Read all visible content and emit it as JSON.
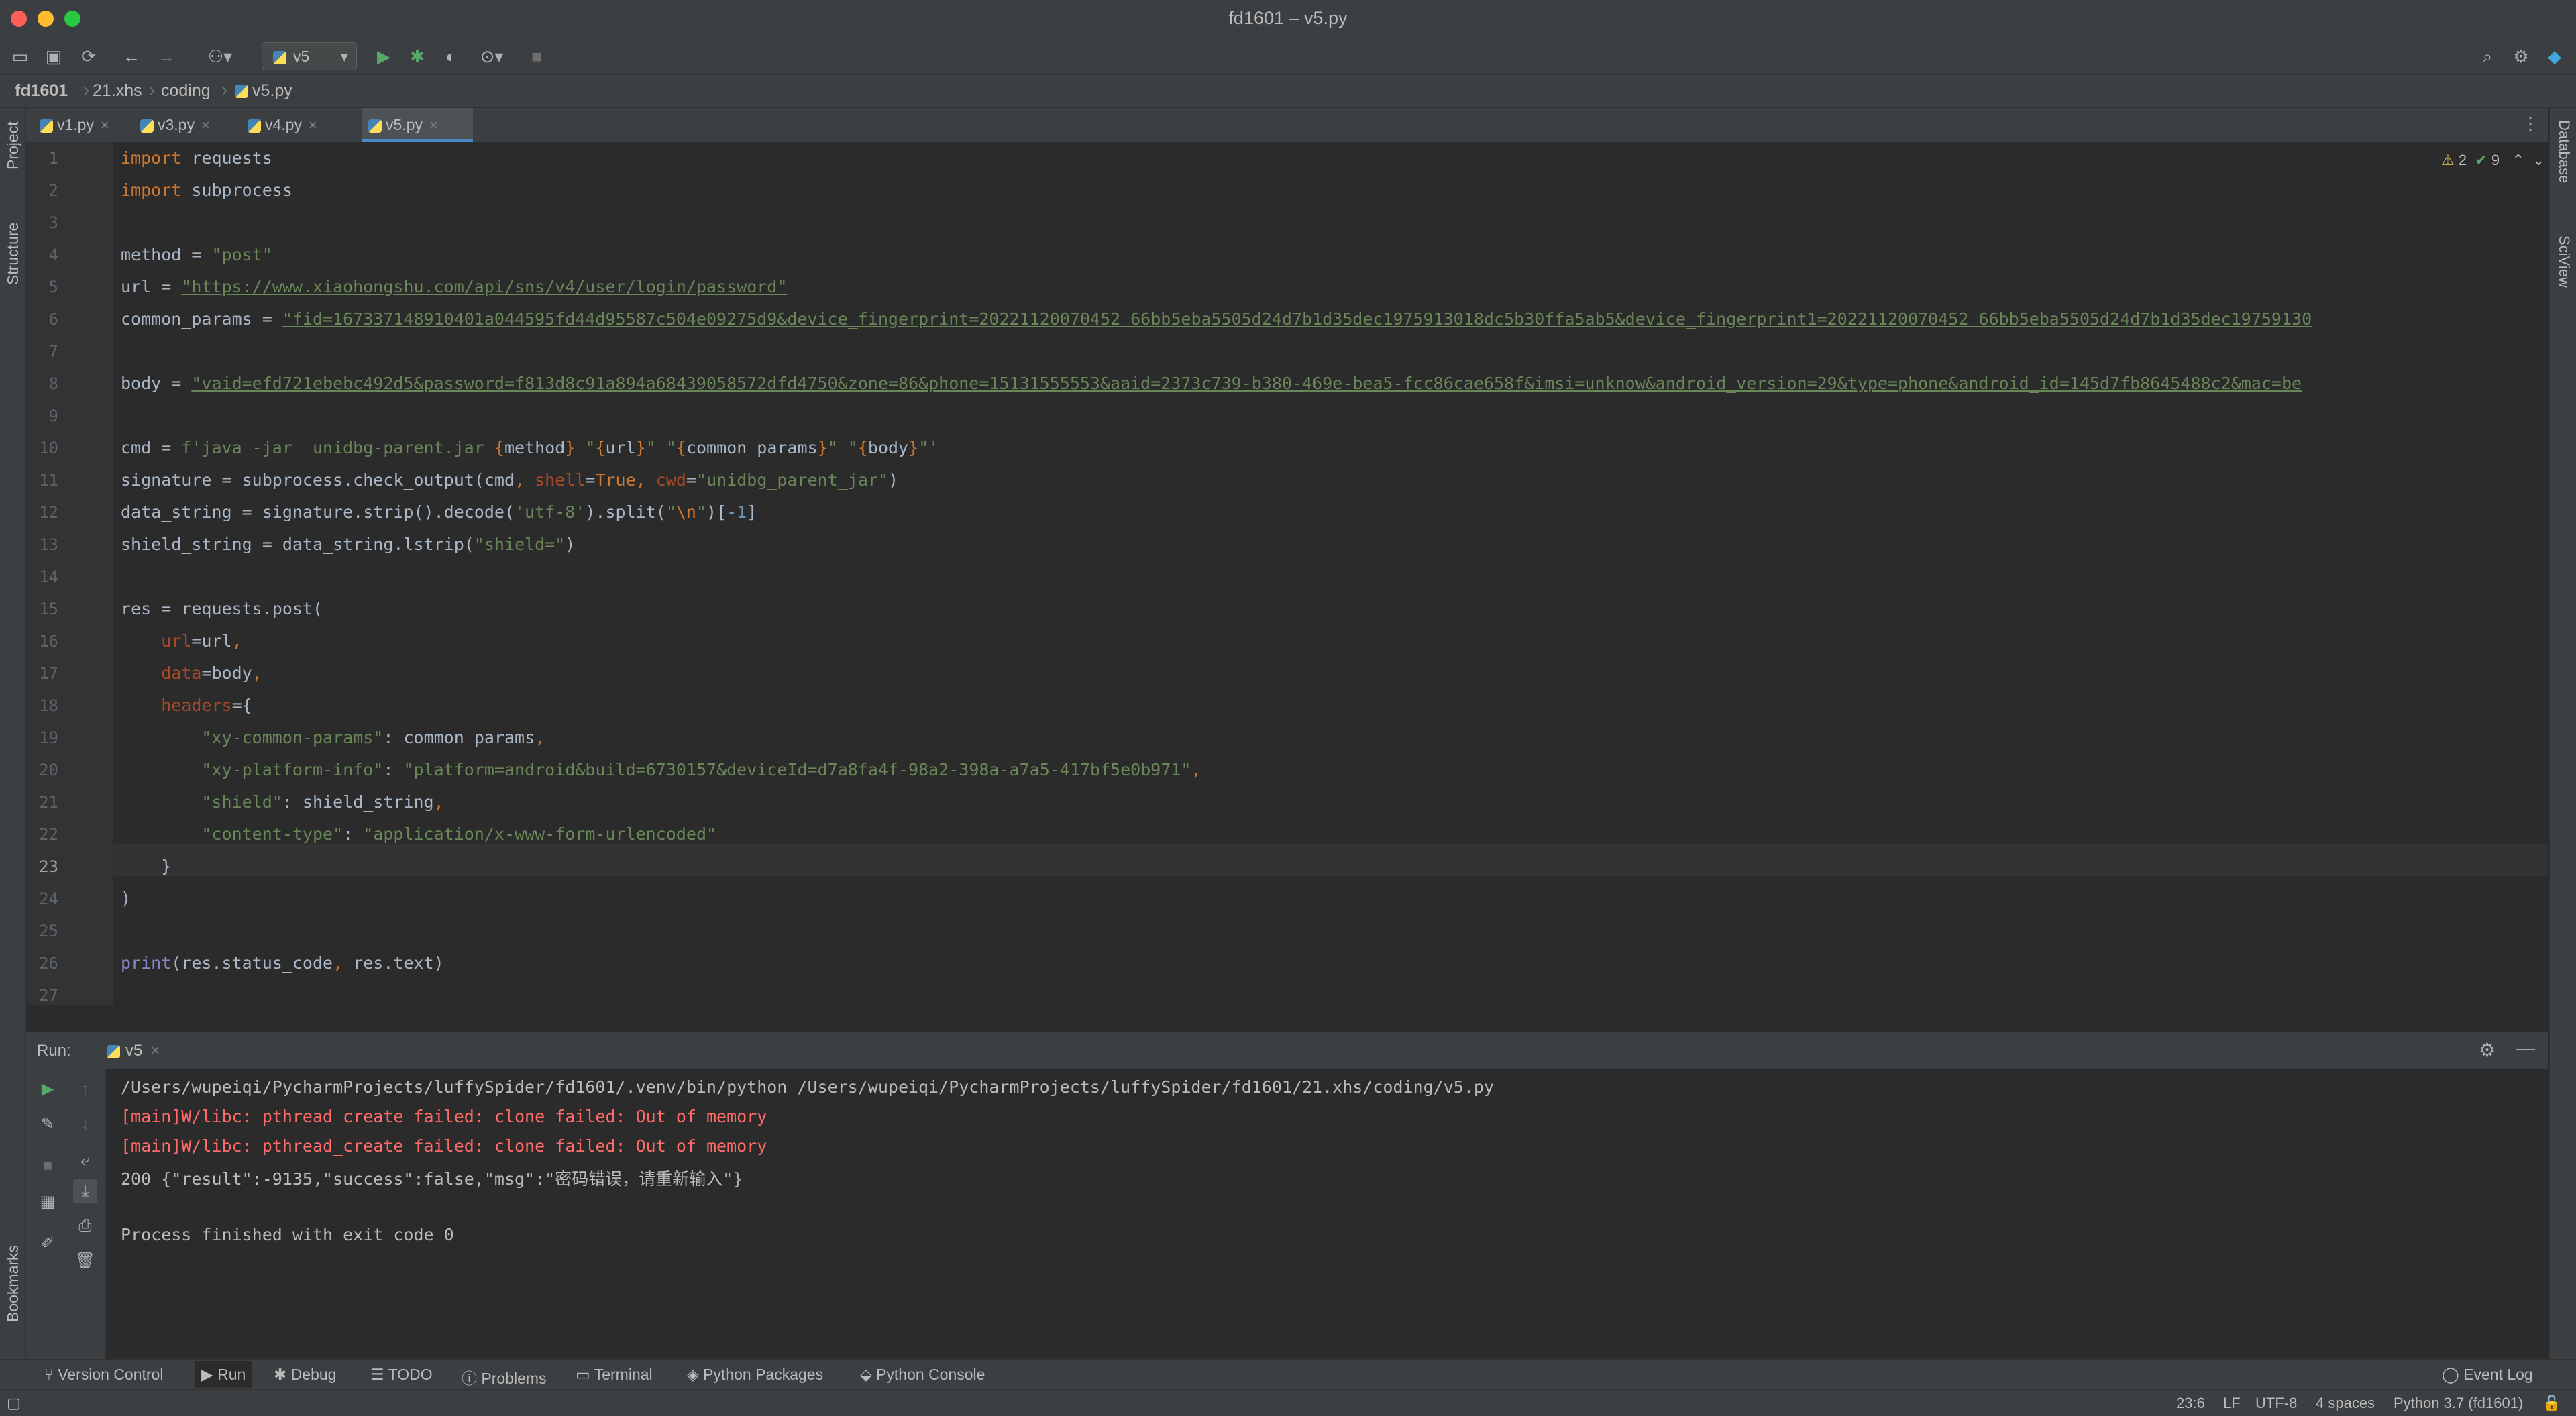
{
  "window": {
    "title": "fd1601 – v5.py"
  },
  "toolbar": {
    "run_config": "v5"
  },
  "breadcrumb": [
    "fd1601",
    "21.xhs",
    "coding",
    "v5.py"
  ],
  "left_tools": [
    "Project",
    "Structure",
    "Bookmarks"
  ],
  "right_tools": [
    "Database",
    "SciView"
  ],
  "tabs": [
    {
      "label": "v1.py"
    },
    {
      "label": "v3.py"
    },
    {
      "label": "v4.py"
    },
    {
      "label": "v5.py",
      "active": true
    }
  ],
  "inspections": {
    "warnings": "2",
    "ok": "9"
  },
  "code_lines": [
    "import requests",
    "import subprocess",
    "",
    "method = \"post\"",
    "url = \"https://www.xiaohongshu.com/api/sns/v4/user/login/password\"",
    "common_params = \"fid=167337148910401a044595fd44d95587c504e09275d9&device_fingerprint=20221120070452 66bb5eba5505d24d7b1d35dec1975913018dc5b30ffa5ab5&device_fingerprint1=20221120070452 66bb5eba5505d24d7b1d35dec19759130",
    "",
    "body = \"vaid=efd721ebebc492d5&password=f813d8c91a894a68439058572dfd4750&zone=86&phone=15131555553&aaid=2373c739-b380-469e-bea5-fcc86cae658f&imsi=unknow&android_version=29&type=phone&android_id=145d7fb8645488c2&mac=be",
    "",
    "cmd = f'java -jar  unidbg-parent.jar {method} \"{url}\" \"{common_params}\" \"{body}\"'",
    "signature = subprocess.check_output(cmd, shell=True, cwd=\"unidbg_parent_jar\")",
    "data_string = signature.strip().decode('utf-8').split(\"\\n\")[-1]",
    "shield_string = data_string.lstrip(\"shield=\")",
    "",
    "res = requests.post(",
    "    url=url,",
    "    data=body,",
    "    headers={",
    "        \"xy-common-params\": common_params,",
    "        \"xy-platform-info\": \"platform=android&build=6730157&deviceId=d7a8fa4f-98a2-398a-a7a5-417bf5e0b971\",",
    "        \"shield\": shield_string,",
    "        \"content-type\": \"application/x-www-form-urlencoded\"",
    "    }",
    ")",
    "",
    "print(res.status_code, res.text)",
    ""
  ],
  "run": {
    "label": "Run:",
    "tab": "v5",
    "output": [
      {
        "text": "/Users/wupeiqi/PycharmProjects/luffySpider/fd1601/.venv/bin/python /Users/wupeiqi/PycharmProjects/luffySpider/fd1601/21.xhs/coding/v5.py",
        "color": "#bbbbbb"
      },
      {
        "text": "[main]W/libc: pthread_create failed: clone failed: Out of memory",
        "color": "#ff6b68"
      },
      {
        "text": "[main]W/libc: pthread_create failed: clone failed: Out of memory",
        "color": "#ff6b68"
      },
      {
        "text": "200 {\"result\":-9135,\"success\":false,\"msg\":\"密码错误，请重新输入\"}",
        "color": "#bbbbbb"
      },
      {
        "text": "",
        "color": "#bbbbbb"
      },
      {
        "text": "Process finished with exit code 0",
        "color": "#bbbbbb"
      }
    ]
  },
  "tool_windows": [
    "Version Control",
    "Run",
    "Debug",
    "TODO",
    "Problems",
    "Terminal",
    "Python Packages",
    "Python Console",
    "Event Log"
  ],
  "status": {
    "position": "23:6",
    "line_sep": "LF",
    "encoding": "UTF-8",
    "indent": "4 spaces",
    "interpreter": "Python 3.7 (fd1601)"
  }
}
